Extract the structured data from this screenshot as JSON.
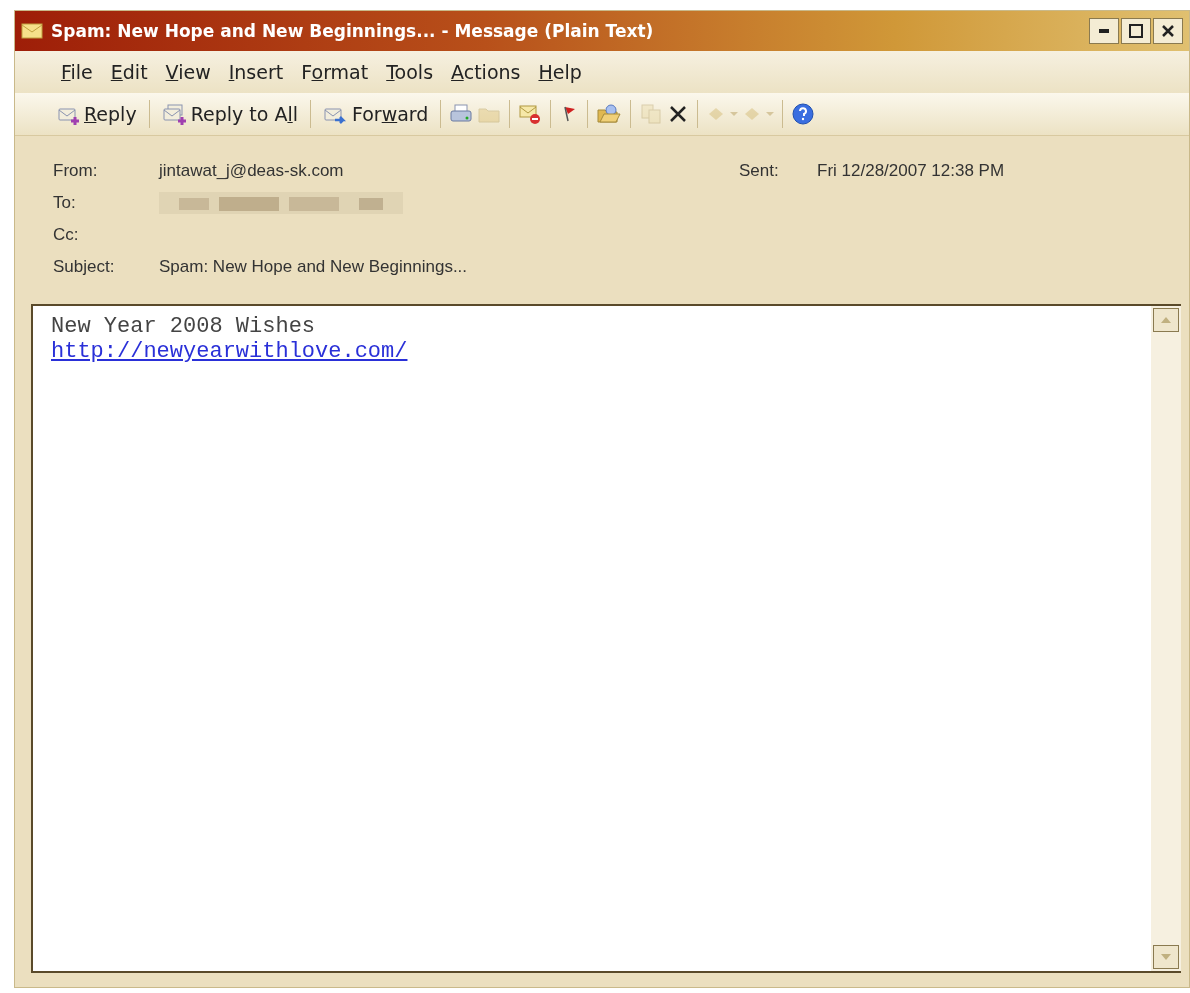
{
  "window": {
    "title": "Spam: New Hope and New Beginnings... - Message (Plain Text)"
  },
  "menu": [
    {
      "key": "F",
      "post": "ile"
    },
    {
      "key": "E",
      "post": "dit"
    },
    {
      "key": "V",
      "post": "iew"
    },
    {
      "key": "I",
      "post": "nsert"
    },
    {
      "pre": "F",
      "key": "o",
      "post": "rmat"
    },
    {
      "key": "T",
      "post": "ools"
    },
    {
      "key": "A",
      "post": "ctions"
    },
    {
      "key": "H",
      "post": "elp"
    }
  ],
  "toolbar": [
    {
      "kind": "reply",
      "key": "R",
      "post": "eply",
      "disabled": false
    },
    {
      "kind": "sep"
    },
    {
      "kind": "reply_all",
      "pre": "Reply to A",
      "key": "l",
      "post": "l",
      "disabled": false
    },
    {
      "kind": "sep"
    },
    {
      "kind": "forward",
      "pre": "For",
      "key": "w",
      "post": "ard",
      "disabled": false
    },
    {
      "kind": "sep"
    },
    {
      "kind": "print",
      "disabled": false
    },
    {
      "kind": "move",
      "disabled": true
    },
    {
      "kind": "sep"
    },
    {
      "kind": "junk",
      "disabled": false
    },
    {
      "kind": "sep"
    },
    {
      "kind": "flag",
      "disabled": false
    },
    {
      "kind": "sep"
    },
    {
      "kind": "folder",
      "disabled": false
    },
    {
      "kind": "sep"
    },
    {
      "kind": "copy",
      "disabled": true
    },
    {
      "kind": "delete",
      "disabled": false
    },
    {
      "kind": "sep"
    },
    {
      "kind": "up",
      "disabled": true
    },
    {
      "kind": "dropdown",
      "disabled": true
    },
    {
      "kind": "down",
      "disabled": true
    },
    {
      "kind": "dropdown",
      "disabled": true
    },
    {
      "kind": "sep"
    },
    {
      "kind": "help",
      "disabled": false
    }
  ],
  "header": {
    "from_label": "From:",
    "from": "jintawat_j@deas-sk.com",
    "sent_label": "Sent:",
    "sent": "Fri 12/28/2007 12:38 PM",
    "to_label": "To:",
    "to": {
      "kind": "blurred"
    },
    "cc_label": "Cc:",
    "subject_label": "Subject:",
    "subject": "Spam: New Hope and New Beginnings..."
  },
  "body": {
    "lines": [
      {
        "kind": "text",
        "text": "New Year 2008 Wishes"
      },
      {
        "kind": "link",
        "text": "http://newyearwithlove.com/"
      }
    ]
  }
}
